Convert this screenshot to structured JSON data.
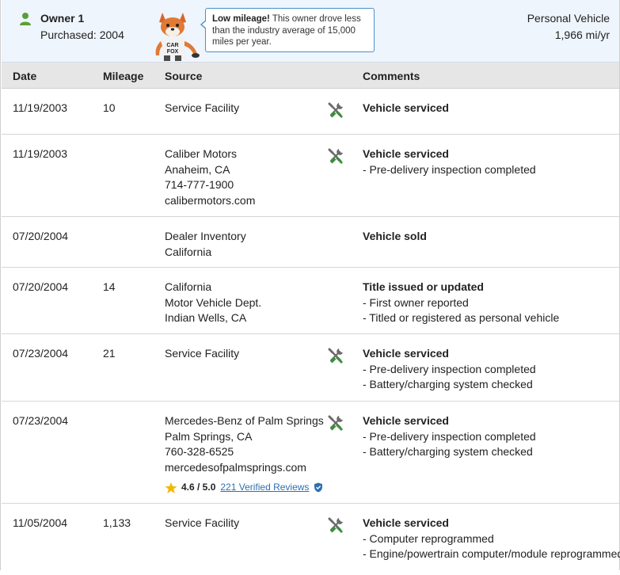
{
  "owner": {
    "name": "Owner 1",
    "purchased": "Purchased: 2004",
    "tip_bold": "Low mileage!",
    "tip_text": " This owner drove less than the industry average of 15,000 miles per year.",
    "type": "Personal Vehicle",
    "rate": "1,966 mi/yr",
    "fox_shirt_line1": "CAR",
    "fox_shirt_line2": "FOX"
  },
  "columns": {
    "date": "Date",
    "mileage": "Mileage",
    "source": "Source",
    "comments": "Comments"
  },
  "records": [
    {
      "date": "11/19/2003",
      "mileage": "10",
      "source": [
        "Service Facility"
      ],
      "service_icon": true,
      "comment_title": "Vehicle serviced",
      "comment_items": []
    },
    {
      "date": "11/19/2003",
      "mileage": "",
      "source": [
        "Caliber Motors",
        "Anaheim, CA",
        "714-777-1900",
        "calibermotors.com"
      ],
      "service_icon": true,
      "comment_title": "Vehicle serviced",
      "comment_items": [
        "- Pre-delivery inspection completed"
      ]
    },
    {
      "date": "07/20/2004",
      "mileage": "",
      "source": [
        "Dealer Inventory",
        "California"
      ],
      "service_icon": false,
      "comment_title": "Vehicle sold",
      "comment_items": []
    },
    {
      "date": "07/20/2004",
      "mileage": "14",
      "source": [
        "California",
        "Motor Vehicle Dept.",
        "Indian Wells, CA"
      ],
      "service_icon": false,
      "comment_title": "Title issued or updated",
      "comment_items": [
        "- First owner reported",
        "- Titled or registered as personal vehicle"
      ]
    },
    {
      "date": "07/23/2004",
      "mileage": "21",
      "source": [
        "Service Facility"
      ],
      "service_icon": true,
      "comment_title": "Vehicle serviced",
      "comment_items": [
        "- Pre-delivery inspection completed",
        "- Battery/charging system checked"
      ]
    },
    {
      "date": "07/23/2004",
      "mileage": "",
      "source": [
        "Mercedes-Benz of Palm Springs",
        "Palm Springs, CA",
        "760-328-6525",
        "mercedesofpalmsprings.com"
      ],
      "service_icon": true,
      "rating": {
        "score": "4.6 / 5.0",
        "reviews": "221 Verified Reviews"
      },
      "comment_title": "Vehicle serviced",
      "comment_items": [
        "- Pre-delivery inspection completed",
        "- Battery/charging system checked"
      ]
    },
    {
      "date": "11/05/2004",
      "mileage": "1,133",
      "source": [
        "Service Facility"
      ],
      "service_icon": true,
      "comment_title": "Vehicle serviced",
      "comment_items": [
        "- Computer reprogrammed",
        "- Engine/powertrain computer/module reprogrammed"
      ]
    }
  ],
  "icons": {
    "owner": "person-icon",
    "service": "wrench-screwdriver-icon",
    "rating": "star-icon",
    "verified": "shield-check-icon"
  },
  "colors": {
    "header_bg": "#eef5fc",
    "table_header_bg": "#e6e6e6",
    "owner_icon": "#5a9e3a",
    "tool_icon_gray": "#6b6b6b",
    "tool_icon_green": "#3a8f3a",
    "link": "#2f6fb0",
    "star": "#f2b705",
    "tip_border": "#4a90c8"
  }
}
